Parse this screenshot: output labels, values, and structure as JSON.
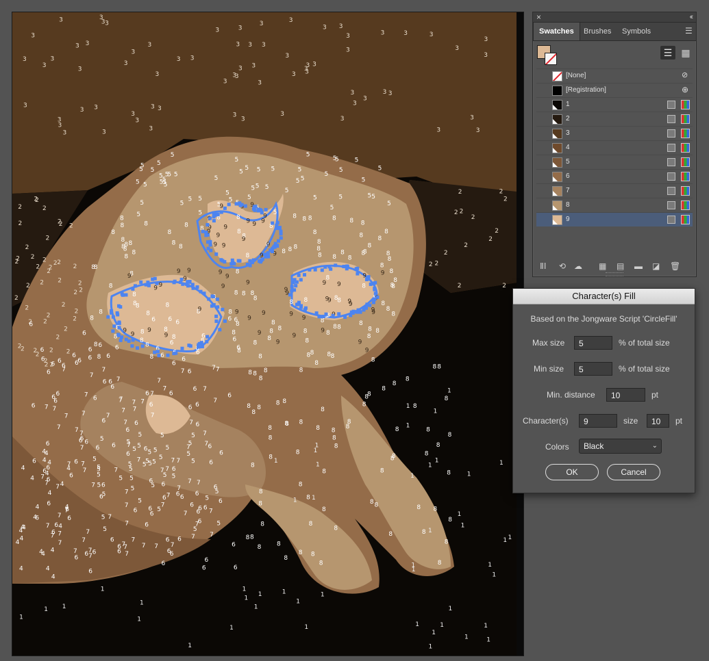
{
  "swatches_panel": {
    "tabs": [
      "Swatches",
      "Brushes",
      "Symbols"
    ],
    "active_tab": "Swatches",
    "fill_color": "#ddb995",
    "items": [
      {
        "label": "[None]",
        "color": "none",
        "icon": "none-icon"
      },
      {
        "label": "[Registration]",
        "color": "#000000",
        "icon": "registration-icon"
      },
      {
        "label": "1",
        "color": "#0b0805"
      },
      {
        "label": "2",
        "color": "#251a10"
      },
      {
        "label": "3",
        "color": "#563a1f"
      },
      {
        "label": "4",
        "color": "#6f4a2c"
      },
      {
        "label": "5",
        "color": "#7d5839"
      },
      {
        "label": "6",
        "color": "#946c49"
      },
      {
        "label": "7",
        "color": "#a5825f"
      },
      {
        "label": "8",
        "color": "#b6966f"
      },
      {
        "label": "9",
        "color": "#ddb995"
      }
    ],
    "selected_item": "9",
    "bottom_icons": [
      "swatch-libraries-icon",
      "place-swatch-icon",
      "cloud-library-icon",
      "swatch-kind-icon",
      "swatch-options-icon",
      "new-color-group-icon",
      "new-swatch-icon",
      "delete-swatch-icon"
    ]
  },
  "dialog": {
    "title": "Character(s) Fill",
    "subtitle": "Based on the Jongware Script 'CircleFill'",
    "max_size_label": "Max size",
    "max_size_value": "5",
    "max_size_unit": "% of total size",
    "min_size_label": "Min size",
    "min_size_value": "5",
    "min_size_unit": "% of total size",
    "min_distance_label": "Min. distance",
    "min_distance_value": "10",
    "min_distance_unit": "pt",
    "characters_label": "Character(s)",
    "characters_value": "9",
    "size_label": "size",
    "size_value": "10",
    "size_unit": "pt",
    "colors_label": "Colors",
    "colors_value": "Black",
    "ok_label": "OK",
    "cancel_label": "Cancel"
  },
  "canvas": {
    "region_labels": [
      "1",
      "2",
      "3",
      "4",
      "5",
      "6",
      "7",
      "8",
      "9"
    ],
    "selection_color": "#4d84f0"
  }
}
